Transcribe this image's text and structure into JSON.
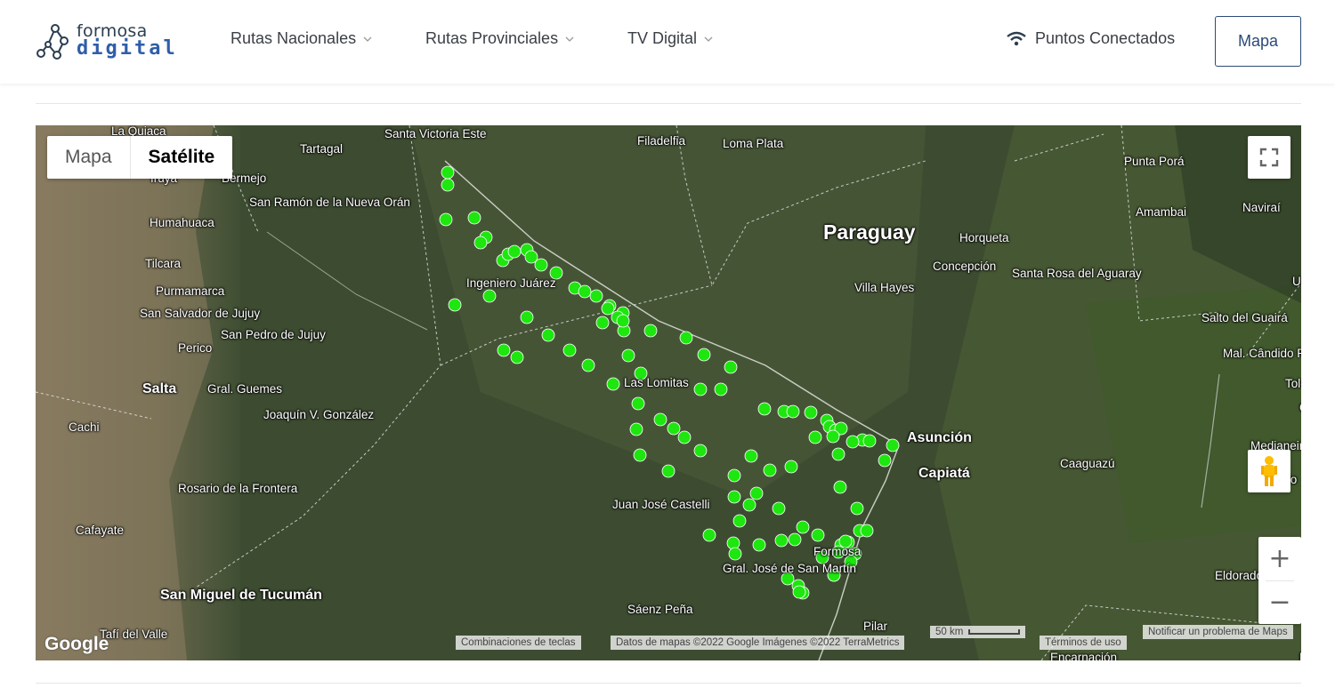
{
  "header": {
    "logo_line1": "formosa",
    "logo_line2": "digital",
    "nav": [
      "Rutas Nacionales",
      "Rutas Provinciales",
      "TV Digital"
    ],
    "puntos_label": "Puntos Conectados",
    "mapa_button": "Mapa"
  },
  "map": {
    "type_map": "Mapa",
    "type_satellite": "Satélite",
    "zoom_in": "+",
    "zoom_out": "−",
    "footer": {
      "shortcuts": "Combinaciones de teclas",
      "data": "Datos de mapas ©2022 Google Imágenes ©2022 TerraMetrics",
      "scale": "50 km",
      "terms": "Términos de uso",
      "report": "Notificar un problema de Maps",
      "google": "Google"
    },
    "marker_color": "#1ee60f",
    "labels": [
      "La Quiaca",
      "Santa Victoria Este",
      "Tartagal",
      "Filadelfia",
      "Loma Plata",
      "Punta Porá",
      "Iruya",
      "Bermejo",
      "San Ramón de la Nueva Orán",
      "Humahuaca",
      "Amambai",
      "Naviraí",
      "Paraguay",
      "Horqueta",
      "Tilcara",
      "Concepción",
      "Santa Rosa del Aguaray",
      "Purmamarca",
      "Ingeniero Juárez",
      "Villa Hayes",
      "San Salvador de Jujuy",
      "Salto del Guairá",
      "Perico",
      "San Pedro de Jujuy",
      "Mal. Cândido Rondon",
      "Salta",
      "Gral. Guemes",
      "Las Lomitas",
      "Toledo",
      "Joaquín V. González",
      "Cachi",
      "Asunción",
      "Capiatá",
      "Caaguazú",
      "Medianeira",
      "Rosario de la Frontera",
      "Foz do",
      "Juan José Castelli",
      "Cafayate",
      "Formosa",
      "Gral. José de San Martín",
      "Eldorado",
      "San Miguel de Tucumán",
      "Sáenz Peña",
      "Pilar",
      "Tafí del Valle",
      "Encarnación",
      "Cas",
      "U",
      "Fr"
    ],
    "markers_count": 98
  }
}
